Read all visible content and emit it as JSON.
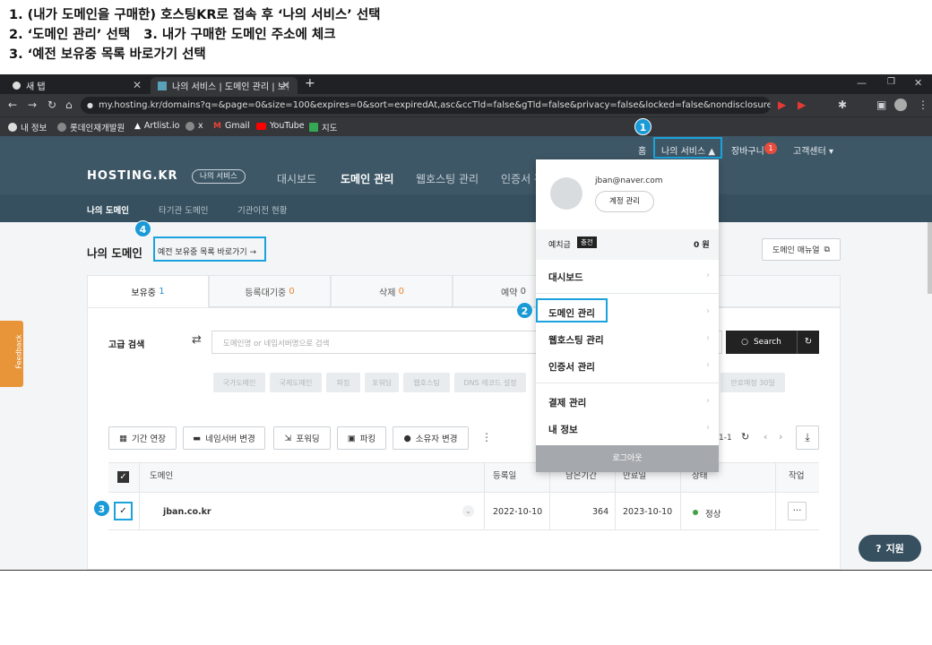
{
  "instructions": [
    "1. (내가 도메인을 구매한) 호스팅KR로 접속 후 ‘나의 서비스’ 선택",
    "2. ‘도메인 관리’ 선택   3. 내가 구매한 도메인 주소에 체크",
    "3. ‘예전 보유중 목록 바로가기 선택"
  ],
  "browser": {
    "tabs": [
      {
        "label": "새 탭"
      },
      {
        "label": "나의 서비스 | 도메인 관리 | 보유"
      }
    ],
    "url": "my.hosting.kr/domains?q=&page=0&size=100&expires=0&sort=expiredAt,asc&ccTld=false&gTld=false&privacy=false&locked=false&nondisclosure=false...",
    "bookmarks": [
      "내 정보",
      "롯데인재개발원",
      "Artlist.io",
      "x",
      "Gmail",
      "YouTube",
      "지도"
    ]
  },
  "header": {
    "top_links": {
      "home": "홈",
      "my_service": "나의 서비스 ▲",
      "cart": "장바구니",
      "cart_count": "1",
      "support": "고객센터 ▾"
    },
    "logo": "HOSTING.KR",
    "logo_badge": "나의 서비스",
    "nav": [
      "대시보드",
      "도메인 관리",
      "웹호스팅 관리",
      "인증서 관"
    ],
    "subnav": [
      "나의 도메인",
      "타기관 도메인",
      "기관이전 현황"
    ]
  },
  "page": {
    "title": "나의 도메인",
    "old_list_link": "예전 보유중 목록 바로가기 →",
    "manual_button": "도메인 매뉴얼",
    "tabs": [
      {
        "label": "보유중",
        "count": "1"
      },
      {
        "label": "등록대기중",
        "count": "0"
      },
      {
        "label": "삭제",
        "count": "0"
      },
      {
        "label": "예약",
        "count": "0"
      }
    ],
    "search_label": "고급 검색",
    "search_placeholder": "도메인명 or 네임서버명으로 검색",
    "search_button": "Search",
    "filter_chips": [
      "국가도메인",
      "국제도메인",
      "파킹",
      "포워딩",
      "웹호스팅",
      "DNS 레코드 설정",
      "만료예정 30일"
    ],
    "actions": [
      "기간 연장",
      "네임서버 변경",
      "포워딩",
      "파킹",
      "소유자 변경"
    ],
    "pagination": "1-1",
    "columns": [
      "도메인",
      "등록일",
      "남은기간",
      "만료일",
      "상태",
      "작업"
    ],
    "rows": [
      {
        "domain": "jban.co.kr",
        "registered": "2022-10-10",
        "remaining": "364",
        "expires": "2023-10-10",
        "status": "정상"
      }
    ],
    "feedback": "Feedback",
    "support_button": "지원"
  },
  "dropdown": {
    "email": "jban@naver.com",
    "account_button": "계정 관리",
    "deposit_label": "예치금",
    "deposit_badge": "충전",
    "deposit_value": "0 원",
    "menu": [
      "대시보드",
      "도메인 관리",
      "웹호스팅 관리",
      "인증서 관리",
      "결제 관리",
      "내 정보"
    ],
    "logout": "로그아웃"
  },
  "markers": [
    "1",
    "2",
    "3",
    "4"
  ],
  "colors": {
    "accent": "#1aa3dc",
    "header": "#3e5766",
    "status_ok": "#43a047"
  }
}
